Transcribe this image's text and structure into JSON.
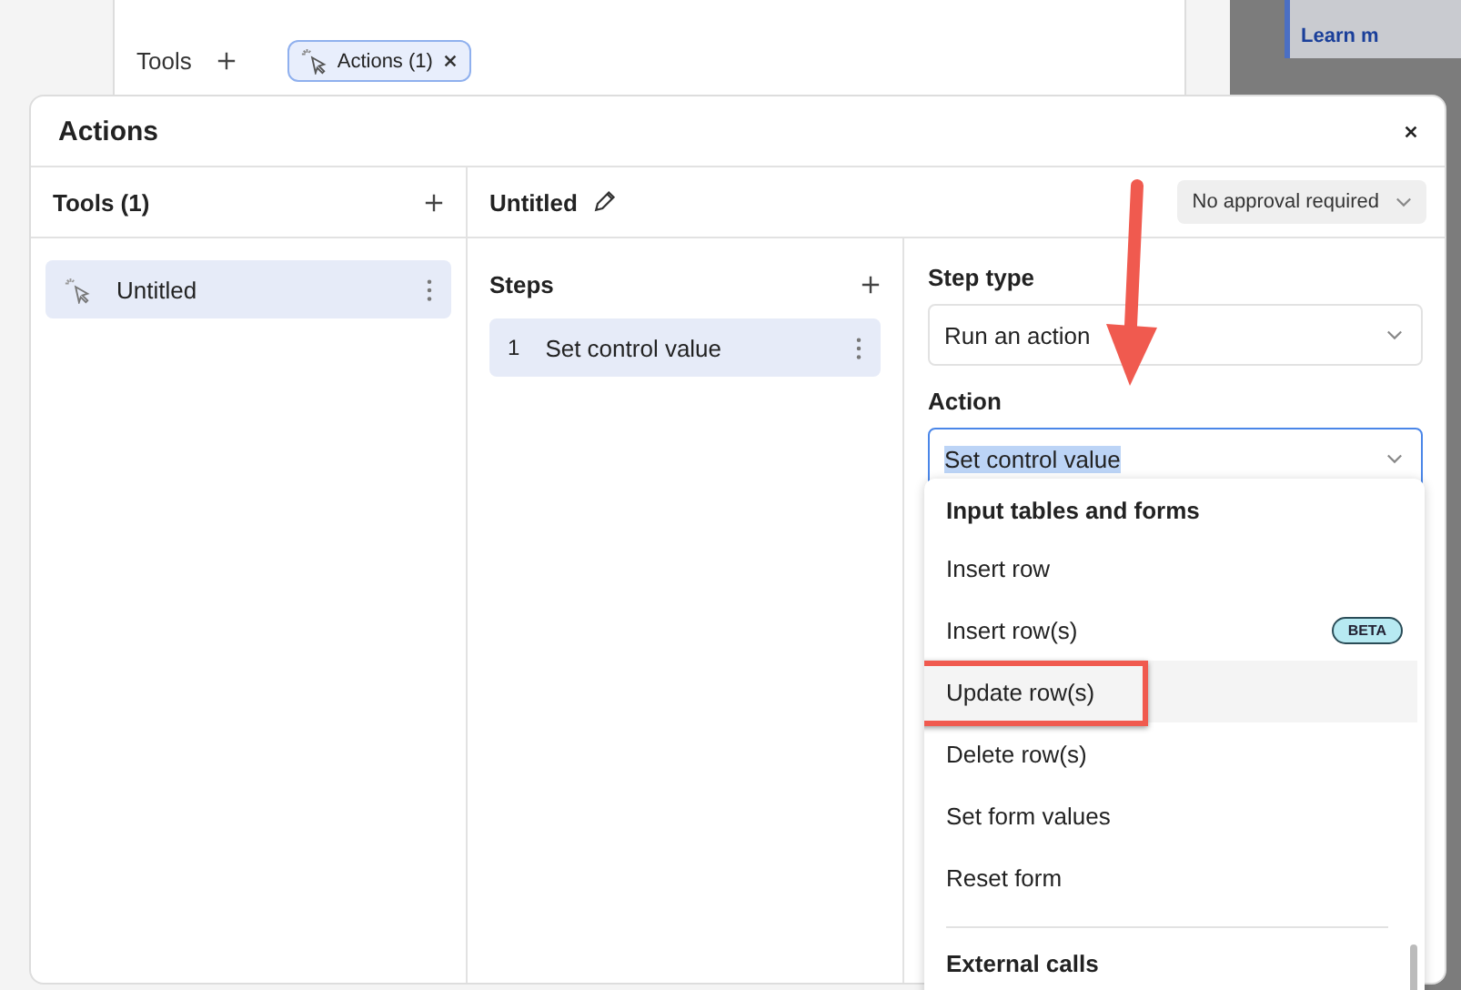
{
  "background": {
    "tools_label": "Tools",
    "chip": {
      "label": "Actions (1)"
    },
    "side_link": "Learn m"
  },
  "modal": {
    "title": "Actions",
    "tools_panel": {
      "title": "Tools (1)",
      "items": [
        {
          "label": "Untitled",
          "selected": true
        }
      ]
    },
    "editor": {
      "title": "Untitled",
      "approval": "No approval required"
    },
    "steps": {
      "title": "Steps",
      "items": [
        {
          "number": "1",
          "label": "Set control value",
          "selected": true
        }
      ]
    },
    "step_type": {
      "label": "Step type",
      "value": "Run an action"
    },
    "action": {
      "label": "Action",
      "value": "Set control value"
    },
    "menu": {
      "groups": [
        {
          "heading": "Input tables and forms",
          "items": [
            {
              "label": "Insert row",
              "hovered": false
            },
            {
              "label": "Insert row(s)",
              "hovered": false,
              "badge": "BETA"
            },
            {
              "label": "Update row(s)",
              "hovered": true
            },
            {
              "label": "Delete row(s)",
              "hovered": false
            },
            {
              "label": "Set form values",
              "hovered": false
            },
            {
              "label": "Reset form",
              "hovered": false
            }
          ]
        },
        {
          "heading": "External calls"
        }
      ]
    }
  }
}
